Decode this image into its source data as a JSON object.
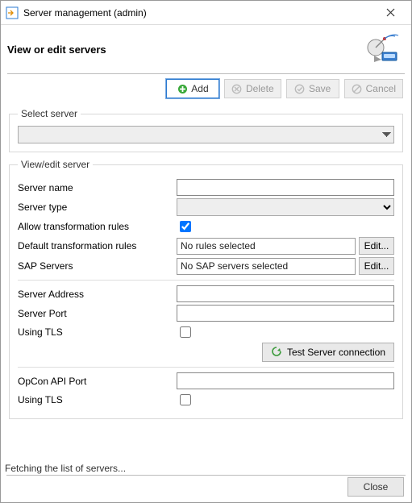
{
  "window": {
    "title": "Server management (admin)"
  },
  "header": {
    "title": "View or edit servers"
  },
  "toolbar": {
    "add": "Add",
    "delete": "Delete",
    "save": "Save",
    "cancel": "Cancel"
  },
  "select_server": {
    "legend": "Select server",
    "value": ""
  },
  "form": {
    "legend": "View/edit server",
    "server_name_label": "Server name",
    "server_name_value": "",
    "server_type_label": "Server type",
    "server_type_value": "",
    "allow_rules_label": "Allow transformation rules",
    "allow_rules_checked": true,
    "default_rules_label": "Default transformation rules",
    "default_rules_value": "No rules selected",
    "edit_label": "Edit...",
    "sap_label": "SAP Servers",
    "sap_value": "No SAP servers selected",
    "server_address_label": "Server Address",
    "server_address_value": "",
    "server_port_label": "Server Port",
    "server_port_value": "",
    "using_tls1_label": "Using TLS",
    "using_tls1_checked": false,
    "test_connection_label": "Test Server connection",
    "opcon_port_label": "OpCon API Port",
    "opcon_port_value": "",
    "using_tls2_label": "Using TLS",
    "using_tls2_checked": false
  },
  "status_text": "Fetching the list of servers...",
  "footer": {
    "close": "Close"
  }
}
